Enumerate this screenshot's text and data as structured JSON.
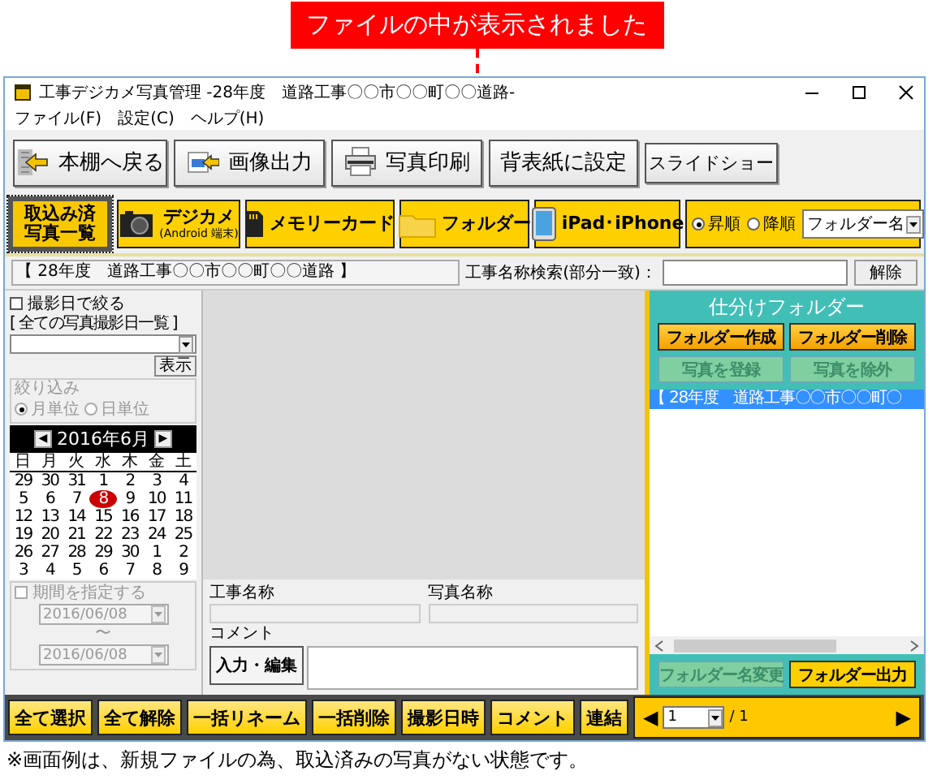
{
  "callout": {
    "text": "ファイルの中が表示されました"
  },
  "window": {
    "title": "工事デジカメ写真管理 -28年度　道路工事〇〇市〇〇町〇〇道路-"
  },
  "menu": [
    "ファイル(F)",
    "設定(C)",
    "ヘルプ(H)"
  ],
  "toolbar": [
    {
      "label": "本棚へ戻る",
      "kind": "back"
    },
    {
      "label": "画像出力",
      "kind": "export"
    },
    {
      "label": "写真印刷",
      "kind": "print"
    },
    {
      "label": "背表紙に設定",
      "kind": "plain"
    },
    {
      "label": "スライドショー",
      "kind": "small"
    }
  ],
  "imported": {
    "lines": [
      "取込み済",
      "写真一覧"
    ],
    "selected": true
  },
  "sources": [
    {
      "label": "デジカメ",
      "sublabel": "(Android 端末)",
      "kind": "camera",
      "selected": false
    },
    {
      "label": "メモリーカード",
      "kind": "card",
      "selected": false
    },
    {
      "label": "フォルダー",
      "kind": "folder",
      "selected": false
    },
    {
      "label": "iPad･iPhone",
      "kind": "tablet",
      "selected": false
    }
  ],
  "sort": {
    "options": [
      {
        "label": "昇順",
        "selected": true
      },
      {
        "label": "降順",
        "selected": false
      }
    ],
    "field": "フォルダー名"
  },
  "project_bar": {
    "project": "【 28年度　道路工事〇〇市〇〇町〇〇道路 】",
    "search_label": "工事名称検索(部分一致)：",
    "clear_button": "解除"
  },
  "filter": {
    "title": "撮影日で絞る",
    "checked": false,
    "list_label": "[ 全ての写真撮影日一覧 ]",
    "show_button": "表示",
    "narrow": {
      "title": "絞り込み",
      "disabled": true,
      "options": [
        {
          "label": "月単位",
          "selected": true
        },
        {
          "label": "日単位",
          "selected": false
        }
      ]
    },
    "calendar": {
      "prev": "◀",
      "month": "2016年6月",
      "next": "▶",
      "weekdays": [
        "日",
        "月",
        "火",
        "水",
        "木",
        "金",
        "土"
      ],
      "days": [
        {
          "label": "29",
          "selected": false
        },
        {
          "label": "30",
          "selected": false
        },
        {
          "label": "31",
          "selected": false
        },
        {
          "label": "1",
          "selected": false
        },
        {
          "label": "2",
          "selected": false
        },
        {
          "label": "3",
          "selected": false
        },
        {
          "label": "4",
          "selected": false
        },
        {
          "label": "5",
          "selected": false
        },
        {
          "label": "6",
          "selected": false
        },
        {
          "label": "7",
          "selected": false
        },
        {
          "label": "8",
          "selected": true
        },
        {
          "label": "9",
          "selected": false
        },
        {
          "label": "10",
          "selected": false
        },
        {
          "label": "11",
          "selected": false
        },
        {
          "label": "12",
          "selected": false
        },
        {
          "label": "13",
          "selected": false
        },
        {
          "label": "14",
          "selected": false
        },
        {
          "label": "15",
          "selected": false
        },
        {
          "label": "16",
          "selected": false
        },
        {
          "label": "17",
          "selected": false
        },
        {
          "label": "18",
          "selected": false
        },
        {
          "label": "19",
          "selected": false
        },
        {
          "label": "20",
          "selected": false
        },
        {
          "label": "21",
          "selected": false
        },
        {
          "label": "22",
          "selected": false
        },
        {
          "label": "23",
          "selected": false
        },
        {
          "label": "24",
          "selected": false
        },
        {
          "label": "25",
          "selected": false
        },
        {
          "label": "26",
          "selected": false
        },
        {
          "label": "27",
          "selected": false
        },
        {
          "label": "28",
          "selected": false
        },
        {
          "label": "29",
          "selected": false
        },
        {
          "label": "30",
          "selected": false
        },
        {
          "label": "1",
          "selected": false
        },
        {
          "label": "2",
          "selected": false
        },
        {
          "label": "3",
          "selected": false
        },
        {
          "label": "4",
          "selected": false
        },
        {
          "label": "5",
          "selected": false
        },
        {
          "label": "6",
          "selected": false
        },
        {
          "label": "7",
          "selected": false
        },
        {
          "label": "8",
          "selected": false
        },
        {
          "label": "9",
          "selected": false
        }
      ]
    },
    "period": {
      "title": "期間を指定する",
      "checked": false,
      "disabled": true,
      "from": "2016/06/08",
      "separator": "〜",
      "to": "2016/06/08"
    }
  },
  "details": {
    "fields": [
      {
        "label": "工事名称"
      },
      {
        "label": "写真名称"
      }
    ],
    "comment_label": "コメント",
    "edit_button": "入力・編集"
  },
  "folders": {
    "title": "仕分けフォルダー",
    "buttons": [
      {
        "label": "フォルダー作成",
        "disabled": false
      },
      {
        "label": "フォルダー削除",
        "disabled": false
      },
      {
        "label": "写真を登録",
        "disabled": true
      },
      {
        "label": "写真を除外",
        "disabled": true
      }
    ],
    "items": [
      {
        "label": "【 28年度　道路工事〇〇市〇〇町〇",
        "selected": true
      }
    ],
    "footer_buttons": [
      {
        "label": "フォルダー名変更",
        "disabled": true
      },
      {
        "label": "フォルダー出力",
        "disabled": false
      }
    ]
  },
  "actions": [
    "全て選択",
    "全て解除",
    "一括リネーム",
    "一括削除",
    "撮影日時",
    "コメント",
    "連結"
  ],
  "pager": {
    "prev": "◀",
    "page": "1",
    "total": "/ 1",
    "next": "▶"
  },
  "footnote": "※画面例は、新規ファイルの為、取込済みの写真がない状態です。"
}
